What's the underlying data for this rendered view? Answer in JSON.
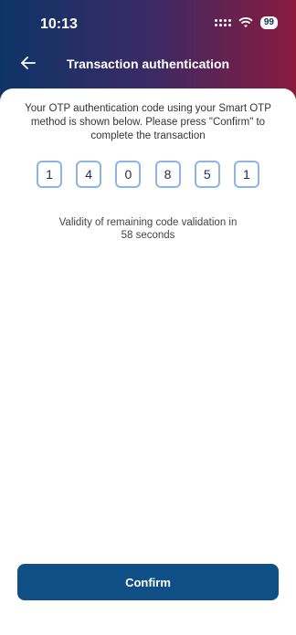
{
  "status_bar": {
    "time": "10:13",
    "battery": "99",
    "icons": [
      "signal-dots-icon",
      "wifi-icon",
      "battery-icon"
    ]
  },
  "nav": {
    "back_icon": "arrow-left-icon",
    "title": "Transaction authentication"
  },
  "content": {
    "description": "Your OTP authentication code using your Smart OTP method is shown below. Please press \"Confirm\" to complete the transaction",
    "otp_digits": [
      "1",
      "4",
      "0",
      "8",
      "5",
      "1"
    ],
    "validity_line1": "Validity of remaining code validation in",
    "validity_line2": "58 seconds"
  },
  "actions": {
    "confirm_label": "Confirm"
  },
  "colors": {
    "header_gradient_start": "#0e3466",
    "header_gradient_end": "#8a1a3e",
    "primary_button": "#0f4f86",
    "otp_border": "#8eb4e6"
  }
}
